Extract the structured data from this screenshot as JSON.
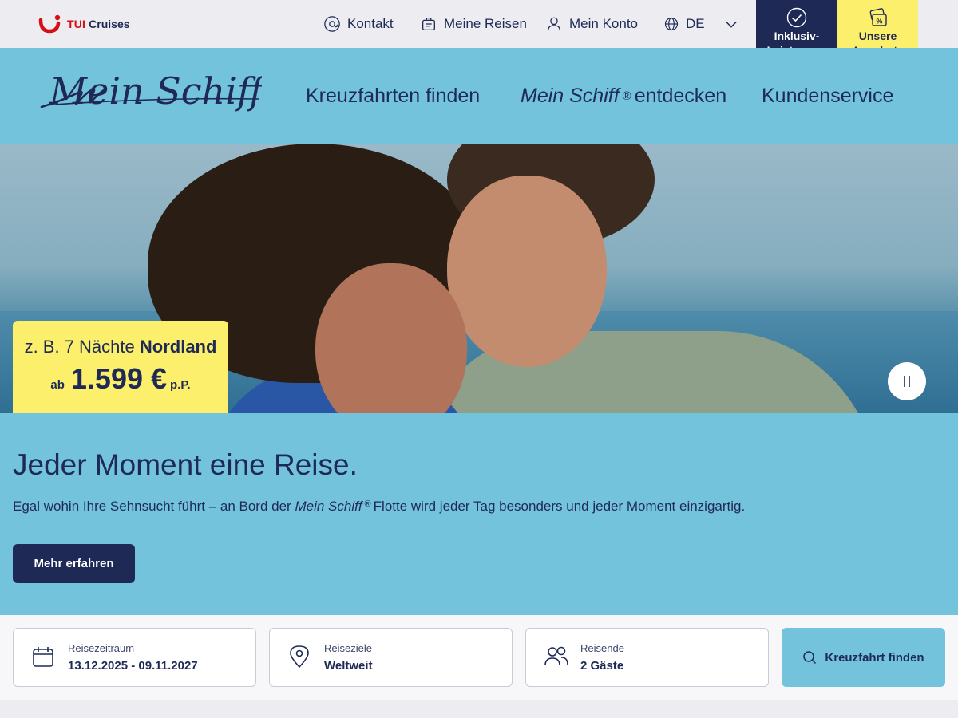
{
  "topbar": {
    "logo_brand": "TUI",
    "logo_sub": "Cruises",
    "kontakt": "Kontakt",
    "meine_reisen": "Meine Reisen",
    "mein_konto": "Mein Konto",
    "language": "DE",
    "inklusiv_line1": "Inklusiv-",
    "inklusiv_line2": "Leistungen",
    "angebote_line1": "Unsere",
    "angebote_line2": "Angebote"
  },
  "header": {
    "brand": "Mein Schiff",
    "nav_kreuzfahrten": "Kreuzfahrten finden",
    "nav_entdecken_brand": "Mein Schiff",
    "nav_entdecken_reg": "®",
    "nav_entdecken_rest": "entdecken",
    "nav_kundenservice": "Kundenservice"
  },
  "hero": {
    "offer_prefix": "z. B. 7 Nächte",
    "offer_destination": "Nordland",
    "offer_ab": "ab",
    "offer_price": "1.599 €",
    "offer_pp": "p.P."
  },
  "intro": {
    "heading": "Jeder Moment eine Reise.",
    "text_before": "Egal wohin Ihre Sehnsucht führt – an Bord der",
    "text_brand": "Mein Schiff",
    "text_reg": "®",
    "text_after": "Flotte wird jeder Tag besonders und jeder Moment einzigartig.",
    "button": "Mehr erfahren"
  },
  "search": {
    "period_label": "Reisezeitraum",
    "period_value": "13.12.2025 - 09.11.2027",
    "dest_label": "Reiseziele",
    "dest_value": "Weltweit",
    "travelers_label": "Reisende",
    "travelers_value": "2 Gäste",
    "submit": "Kreuzfahrt finden"
  },
  "colors": {
    "navy": "#1e2a55",
    "sky": "#74c3dd",
    "yellow": "#fbef6b",
    "tui_red": "#d40e14"
  },
  "icons": [
    "at-icon",
    "suitcase-icon",
    "user-icon",
    "globe-icon",
    "chevron-down-icon",
    "check-circle-icon",
    "percent-tag-icon",
    "pause-icon",
    "calendar-icon",
    "location-pin-icon",
    "people-icon",
    "search-icon"
  ]
}
